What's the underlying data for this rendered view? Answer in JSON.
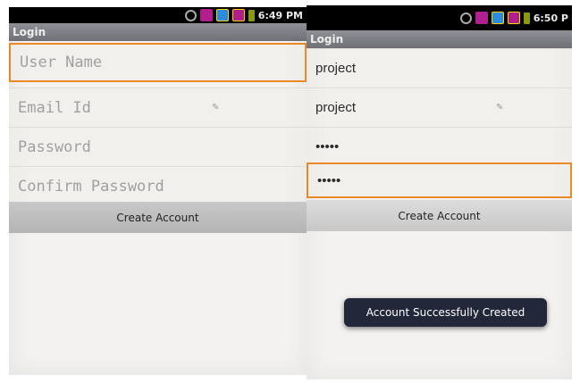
{
  "left_screen": {
    "status": {
      "time": "6:49 PM"
    },
    "title": "Login",
    "fields": {
      "username_placeholder": "User Name",
      "email_placeholder": "Email Id",
      "password_placeholder": "Password",
      "confirm_placeholder": "Confirm Password"
    },
    "create_button": "Create Account"
  },
  "right_screen": {
    "status": {
      "time": "6:50 P"
    },
    "title": "Login",
    "fields": {
      "username_value": "project",
      "email_value": "project",
      "password_value": "•••••",
      "confirm_value": "•••••"
    },
    "create_button": "Create Account",
    "toast": "Account Successfully Created"
  },
  "colors": {
    "focus_orange": "#e88a2a",
    "toast_bg": "#22273a",
    "title_bar": "#7a7c82"
  },
  "icons": [
    "sync-icon",
    "usb-icon",
    "signal-icon",
    "signal-bars-icon",
    "battery-icon",
    "pencil-icon"
  ]
}
